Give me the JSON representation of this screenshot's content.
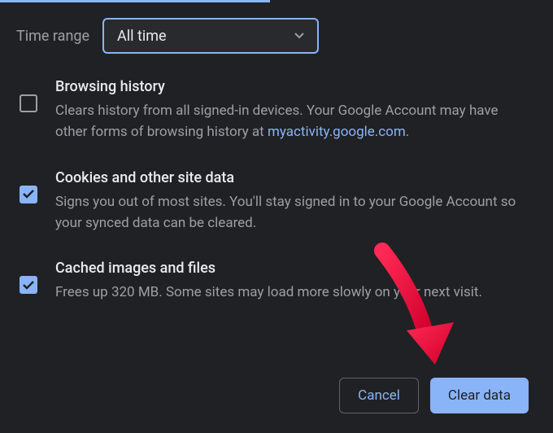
{
  "time_range": {
    "label": "Time range",
    "selected": "All time"
  },
  "options": {
    "browsing_history": {
      "title": "Browsing history",
      "desc_prefix": "Clears history from all signed-in devices. Your Google Account may have other forms of browsing history at ",
      "link_text": "myactivity.google.com",
      "desc_suffix": ".",
      "checked": false
    },
    "cookies": {
      "title": "Cookies and other site data",
      "desc": "Signs you out of most sites. You'll stay signed in to your Google Account so your synced data can be cleared.",
      "checked": true
    },
    "cache": {
      "title": "Cached images and files",
      "desc": "Frees up 320 MB. Some sites may load more slowly on your next visit.",
      "checked": true
    }
  },
  "actions": {
    "cancel": "Cancel",
    "clear_data": "Clear data"
  },
  "colors": {
    "accent": "#8ab4f8",
    "annotation_arrow": "#ff003c"
  }
}
